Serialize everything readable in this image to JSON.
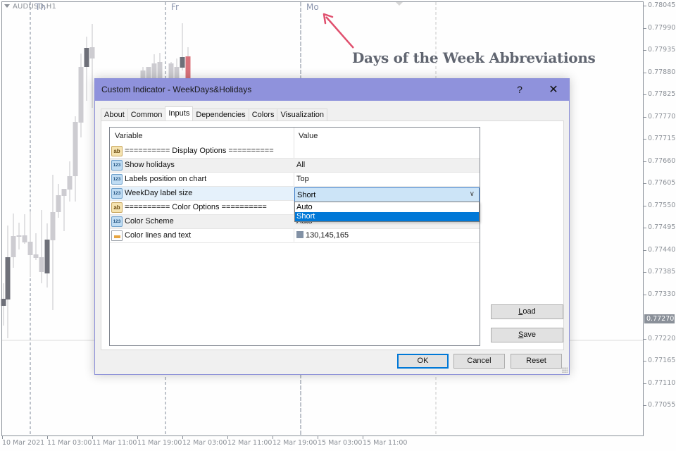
{
  "chart": {
    "symbol": "AUDUSD,H1",
    "day_labels": [
      {
        "label": "Th",
        "x_ref": "10 Mar 2021"
      },
      {
        "label": "Fr",
        "x_ref": "12 Mar"
      },
      {
        "label": "Mo",
        "x_ref": "15 Mar"
      }
    ],
    "price_axis": [
      "0.78045",
      "0.77990",
      "0.77935",
      "0.77880",
      "0.77825",
      "0.77770",
      "0.77715",
      "0.77660",
      "0.77605",
      "0.77550",
      "0.77495",
      "0.77440",
      "0.77385",
      "0.77330",
      "0.77220",
      "0.77165",
      "0.77110",
      "0.77055"
    ],
    "current_price": "0.77270",
    "time_axis": [
      "10 Mar 2021",
      "11 Mar 03:00",
      "11 Mar 11:00",
      "11 Mar 19:00",
      "12 Mar 03:00",
      "12 Mar 11:00",
      "12 Mar 19:00",
      "15 Mar 03:00",
      "15 Mar 11:00"
    ],
    "colors": {
      "bull": "#cdccd1",
      "bear": "#6e7079",
      "highlight": "#d9727b",
      "day_label": "#8a94ad",
      "annotation_arrow": "#e0506e"
    }
  },
  "annotation": {
    "text": "Days of the Week Abbreviations"
  },
  "dialog": {
    "title": "Custom Indicator - WeekDays&Holidays",
    "help_label": "?",
    "close_label": "✕",
    "tabs": [
      {
        "label": "About",
        "active": false
      },
      {
        "label": "Common",
        "active": false
      },
      {
        "label": "Inputs",
        "active": true
      },
      {
        "label": "Dependencies",
        "active": false
      },
      {
        "label": "Colors",
        "active": false
      },
      {
        "label": "Visualization",
        "active": false
      }
    ],
    "grid": {
      "headers": {
        "variable": "Variable",
        "value": "Value"
      },
      "rows": [
        {
          "icon": "ab",
          "name": "========== Display Options ==========",
          "value": ""
        },
        {
          "icon": "123",
          "name": "Show holidays",
          "value": "All"
        },
        {
          "icon": "123",
          "name": "Labels position on chart",
          "value": "Top"
        },
        {
          "icon": "123",
          "name": "WeekDay label size",
          "value": "Short"
        },
        {
          "icon": "ab",
          "name": "========== Color Options ==========",
          "value": ""
        },
        {
          "icon": "123",
          "name": "Color Scheme",
          "value": "Auto"
        },
        {
          "icon": "color",
          "name": "Color lines and text",
          "value": "130,145,165"
        }
      ]
    },
    "combo": {
      "selected": "Short",
      "options": [
        "Auto",
        "Short"
      ],
      "highlighted": "Short"
    },
    "buttons": {
      "load": "Load",
      "save": "Save",
      "ok": "OK",
      "cancel": "Cancel",
      "reset": "Reset"
    }
  }
}
